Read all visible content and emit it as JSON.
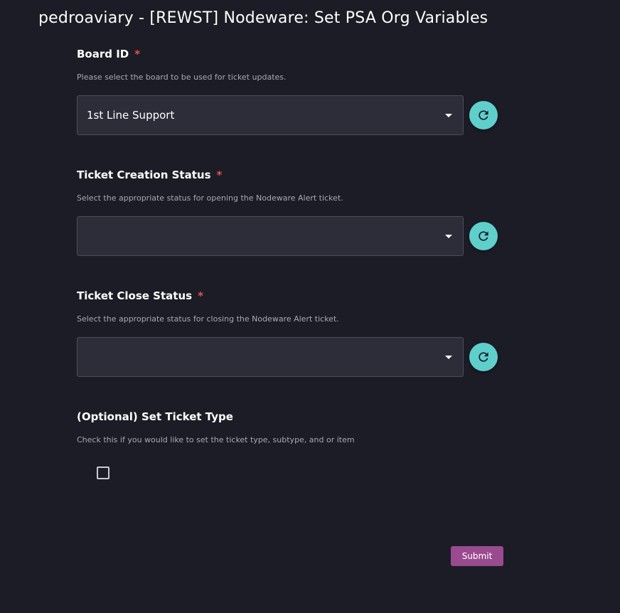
{
  "page": {
    "title": "pedroaviary - [REWST] Nodeware: Set PSA Org Variables"
  },
  "fields": [
    {
      "label": "Board ID",
      "required_marker": "*",
      "help": "Please select the board to be used for ticket updates.",
      "value": "1st Line Support"
    },
    {
      "label": "Ticket Creation Status",
      "required_marker": "*",
      "help": "Select the appropriate status for opening the Nodeware Alert ticket.",
      "value": ""
    },
    {
      "label": "Ticket Close Status",
      "required_marker": "*",
      "help": "Select the appropriate status for closing the Nodeware Alert ticket.",
      "value": ""
    }
  ],
  "optional": {
    "label": "(Optional) Set Ticket Type",
    "help": "Check this if you would like to set the ticket type, subtype, and or item",
    "checked": false
  },
  "actions": {
    "submit_label": "Submit"
  },
  "colors": {
    "background": "#1c1c26",
    "input_background": "#2d2d3a",
    "refresh_accent": "#5fcfcc",
    "submit_accent": "#9a4b8f",
    "required": "#e8504d"
  },
  "icons": {
    "refresh": "refresh-icon",
    "dropdown": "caret-down-icon"
  }
}
